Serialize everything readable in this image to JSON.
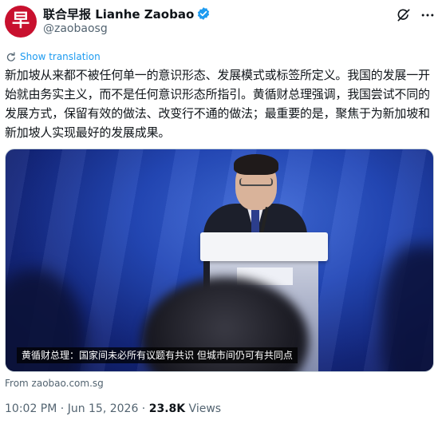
{
  "account": {
    "display_name": "联合早报 Lianhe Zaobao",
    "handle": "@zaobaosg",
    "avatar_glyph": "早",
    "avatar_color": "#c8102e",
    "verified_color": "#1d9bf0"
  },
  "translate": {
    "label": "Show translation"
  },
  "tweet": {
    "text": "新加坡从来都不被任何单一的意识形态、发展模式或标签所定义。我国的发展一开始就由务实主义，而不是任何意识形态所指引。黄循财总理强调，我国尝试不同的发展方式，保留有效的做法、改变行不通的做法；最重要的是，聚焦于为新加坡和新加坡人实现最好的发展成果。"
  },
  "media": {
    "caption": "黄循财总理：国家间未必所有议题有共识 但城市间仍可有共同点"
  },
  "source": {
    "text": "From zaobao.com.sg"
  },
  "meta": {
    "time": "10:02 PM",
    "separator": " · ",
    "date": "Jun 15, 2026",
    "views_count": "23.8K",
    "views_label": " Views"
  },
  "icons": {
    "grok": "grok-icon",
    "more": "more-icon",
    "translate": "translate-icon",
    "verified": "verified-badge-icon"
  }
}
